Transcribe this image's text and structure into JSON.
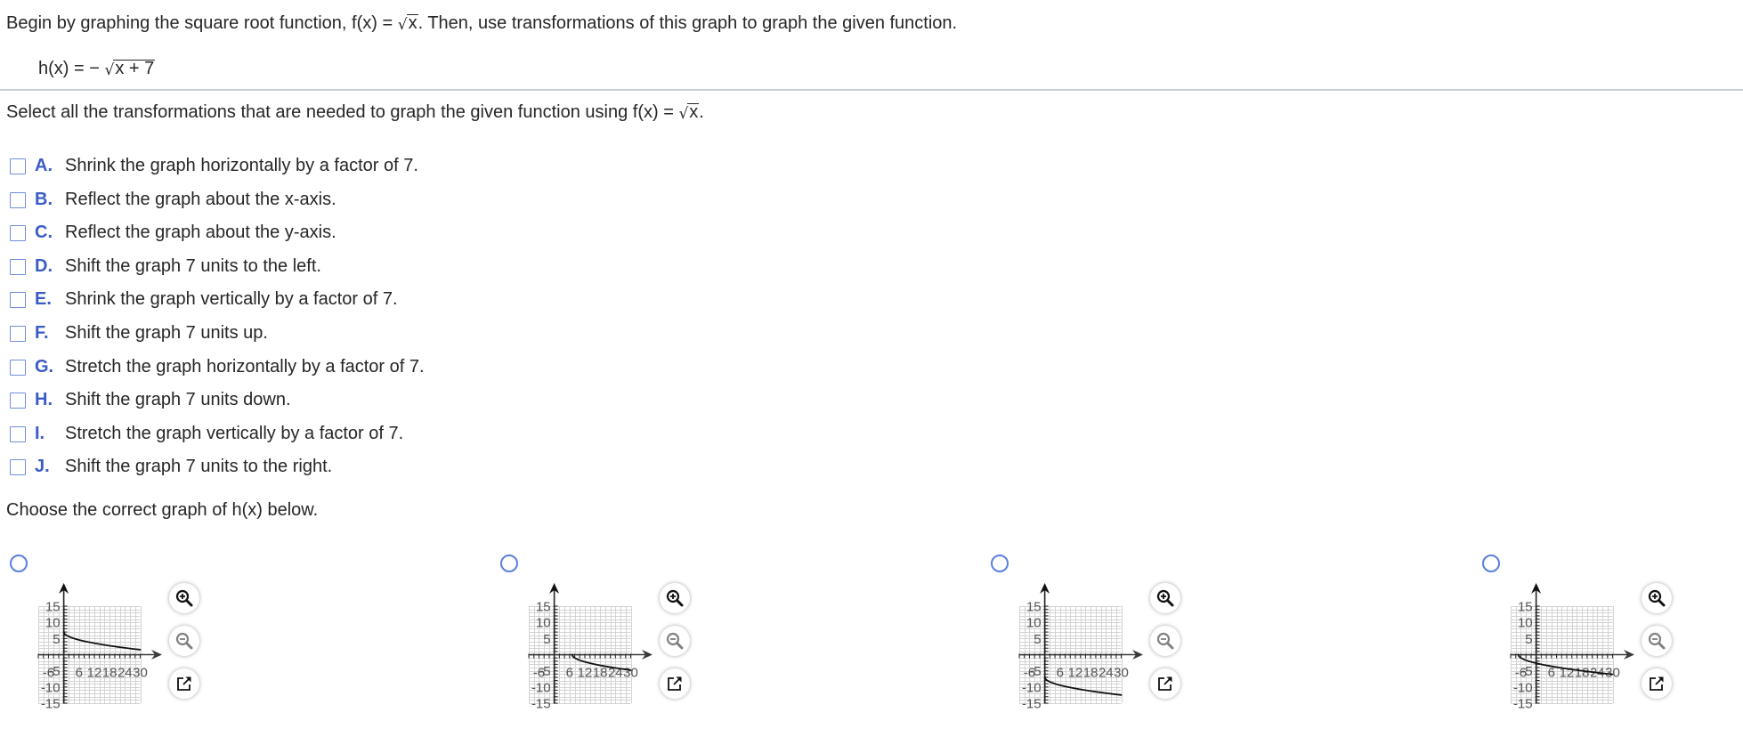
{
  "question": {
    "intro": {
      "before": "Begin by graphing the square root function, f(x) = ",
      "radicand": "x",
      "after": ". Then, use transformations of this graph to graph the given function."
    },
    "given_function": {
      "lhs": "h(x) = ",
      "sign": "− ",
      "radicand": "x + 7"
    }
  },
  "transformations": {
    "prompt": {
      "before": "Select all the transformations that are needed to graph the given function using f(x) = ",
      "radicand": "x",
      "after": "."
    },
    "options": [
      {
        "letter": "A.",
        "text": "Shrink the graph horizontally by a factor of 7.",
        "checked": false
      },
      {
        "letter": "B.",
        "text": "Reflect the graph about the x-axis.",
        "checked": false
      },
      {
        "letter": "C.",
        "text": "Reflect the graph about the y-axis.",
        "checked": false
      },
      {
        "letter": "D.",
        "text": "Shift the graph 7 units to the left.",
        "checked": false
      },
      {
        "letter": "E.",
        "text": "Shrink the graph vertically by a factor of 7.",
        "checked": false
      },
      {
        "letter": "F.",
        "text": "Shift the graph 7 units up.",
        "checked": false
      },
      {
        "letter": "G.",
        "text": "Stretch the graph horizontally by a factor of 7.",
        "checked": false
      },
      {
        "letter": "H.",
        "text": "Shift the graph 7 units down.",
        "checked": false
      },
      {
        "letter": "I.",
        "text": "Stretch the graph vertically by a factor of 7.",
        "checked": false
      },
      {
        "letter": "J.",
        "text": "Shift the graph 7 units to the right.",
        "checked": false
      }
    ]
  },
  "graph_choice": {
    "prompt": "Choose the correct graph of h(x) below.",
    "choices": [
      {
        "selected": false
      },
      {
        "selected": false
      },
      {
        "selected": false
      },
      {
        "selected": false
      }
    ],
    "tools": [
      {
        "name": "zoom-in",
        "icon": "zoom-in-icon",
        "enabled": true
      },
      {
        "name": "zoom-out",
        "icon": "zoom-out-icon",
        "enabled": false
      },
      {
        "name": "open-in-new-window",
        "icon": "popout-icon",
        "enabled": true
      }
    ]
  },
  "colors": {
    "text": "#262626",
    "option_letter": "#3b5cc4",
    "checkbox_border": "#6f8ede",
    "radio_border": "#5b7fe0",
    "divider": "#c9ced8",
    "curve": "#111111",
    "grid": "#d3d3d3",
    "disabled_icon": "#808080"
  },
  "chart_data": [
    {
      "type": "line",
      "title": "",
      "xlabel": "",
      "ylabel": "",
      "xlim": [
        -10,
        30
      ],
      "ylim": [
        -15,
        15
      ],
      "grid": true,
      "grid_step": {
        "x": 2,
        "y": 1
      },
      "tick_step": {
        "x": 2,
        "y": 1
      },
      "xticks": [
        {
          "value": -6,
          "label": "-6"
        },
        {
          "value": 6,
          "label": "6"
        },
        {
          "value": 12,
          "label": "12"
        },
        {
          "value": 18,
          "label": "18"
        },
        {
          "value": 24,
          "label": "24"
        },
        {
          "value": 30,
          "label": "30"
        }
      ],
      "yticks": [
        {
          "value": 15,
          "label": "15"
        },
        {
          "value": 10,
          "label": "10"
        },
        {
          "value": 5,
          "label": "5"
        },
        {
          "value": -5,
          "label": "-5"
        },
        {
          "value": -10,
          "label": "-10"
        },
        {
          "value": -15,
          "label": "-15"
        }
      ],
      "series": [
        {
          "name": "curve",
          "points": [
            [
              0,
              7
            ],
            [
              0.25,
              6.5
            ],
            [
              0.5,
              6.29
            ],
            [
              1,
              6
            ],
            [
              2,
              5.59
            ],
            [
              3,
              5.27
            ],
            [
              4,
              5
            ],
            [
              6,
              4.55
            ],
            [
              8,
              4.17
            ],
            [
              10,
              3.84
            ],
            [
              12,
              3.54
            ],
            [
              15,
              3.13
            ],
            [
              18,
              2.76
            ],
            [
              21,
              2.42
            ],
            [
              24,
              2.1
            ],
            [
              27,
              1.8
            ],
            [
              30,
              1.52
            ]
          ]
        }
      ]
    },
    {
      "type": "line",
      "title": "",
      "xlabel": "",
      "ylabel": "",
      "xlim": [
        -10,
        30
      ],
      "ylim": [
        -15,
        15
      ],
      "grid": true,
      "grid_step": {
        "x": 2,
        "y": 1
      },
      "tick_step": {
        "x": 2,
        "y": 1
      },
      "xticks": [
        {
          "value": -6,
          "label": "-6"
        },
        {
          "value": 6,
          "label": "6"
        },
        {
          "value": 12,
          "label": "12"
        },
        {
          "value": 18,
          "label": "18"
        },
        {
          "value": 24,
          "label": "24"
        },
        {
          "value": 30,
          "label": "30"
        }
      ],
      "yticks": [
        {
          "value": 15,
          "label": "15"
        },
        {
          "value": 10,
          "label": "10"
        },
        {
          "value": 5,
          "label": "5"
        },
        {
          "value": -5,
          "label": "-5"
        },
        {
          "value": -10,
          "label": "-10"
        },
        {
          "value": -15,
          "label": "-15"
        }
      ],
      "series": [
        {
          "name": "curve",
          "points": [
            [
              7,
              0
            ],
            [
              7.25,
              -0.5
            ],
            [
              7.5,
              -0.71
            ],
            [
              8,
              -1
            ],
            [
              9,
              -1.41
            ],
            [
              10,
              -1.73
            ],
            [
              11,
              -2
            ],
            [
              13,
              -2.45
            ],
            [
              15,
              -2.83
            ],
            [
              17,
              -3.16
            ],
            [
              19,
              -3.46
            ],
            [
              22,
              -3.87
            ],
            [
              25,
              -4.24
            ],
            [
              28,
              -4.58
            ],
            [
              30,
              -4.8
            ]
          ]
        }
      ]
    },
    {
      "type": "line",
      "title": "",
      "xlabel": "",
      "ylabel": "",
      "xlim": [
        -10,
        30
      ],
      "ylim": [
        -15,
        15
      ],
      "grid": true,
      "grid_step": {
        "x": 2,
        "y": 1
      },
      "tick_step": {
        "x": 2,
        "y": 1
      },
      "xticks": [
        {
          "value": -6,
          "label": "-6"
        },
        {
          "value": 6,
          "label": "6"
        },
        {
          "value": 12,
          "label": "12"
        },
        {
          "value": 18,
          "label": "18"
        },
        {
          "value": 24,
          "label": "24"
        },
        {
          "value": 30,
          "label": "30"
        }
      ],
      "yticks": [
        {
          "value": 15,
          "label": "15"
        },
        {
          "value": 10,
          "label": "10"
        },
        {
          "value": 5,
          "label": "5"
        },
        {
          "value": -5,
          "label": "-5"
        },
        {
          "value": -10,
          "label": "-10"
        },
        {
          "value": -15,
          "label": "-15"
        }
      ],
      "series": [
        {
          "name": "curve",
          "points": [
            [
              0,
              -7
            ],
            [
              0.25,
              -7.5
            ],
            [
              0.5,
              -7.71
            ],
            [
              1,
              -8
            ],
            [
              2,
              -8.41
            ],
            [
              3,
              -8.73
            ],
            [
              4,
              -9
            ],
            [
              6,
              -9.45
            ],
            [
              8,
              -9.83
            ],
            [
              10,
              -10.16
            ],
            [
              12,
              -10.46
            ],
            [
              15,
              -10.87
            ],
            [
              18,
              -11.24
            ],
            [
              21,
              -11.58
            ],
            [
              24,
              -11.9
            ],
            [
              27,
              -12.2
            ],
            [
              30,
              -12.48
            ]
          ]
        }
      ]
    },
    {
      "type": "line",
      "title": "",
      "xlabel": "",
      "ylabel": "",
      "xlim": [
        -10,
        30
      ],
      "ylim": [
        -15,
        15
      ],
      "grid": true,
      "grid_step": {
        "x": 2,
        "y": 1
      },
      "tick_step": {
        "x": 2,
        "y": 1
      },
      "xticks": [
        {
          "value": -6,
          "label": "-6"
        },
        {
          "value": 6,
          "label": "6"
        },
        {
          "value": 12,
          "label": "12"
        },
        {
          "value": 18,
          "label": "18"
        },
        {
          "value": 24,
          "label": "24"
        },
        {
          "value": 30,
          "label": "30"
        }
      ],
      "yticks": [
        {
          "value": 15,
          "label": "15"
        },
        {
          "value": 10,
          "label": "10"
        },
        {
          "value": 5,
          "label": "5"
        },
        {
          "value": -5,
          "label": "-5"
        },
        {
          "value": -10,
          "label": "-10"
        },
        {
          "value": -15,
          "label": "-15"
        }
      ],
      "series": [
        {
          "name": "curve",
          "points": [
            [
              -7,
              0
            ],
            [
              -6.75,
              -0.5
            ],
            [
              -6.5,
              -0.71
            ],
            [
              -6,
              -1
            ],
            [
              -5,
              -1.41
            ],
            [
              -4,
              -1.73
            ],
            [
              -3,
              -2
            ],
            [
              -1,
              -2.45
            ],
            [
              1,
              -2.83
            ],
            [
              3,
              -3.16
            ],
            [
              5,
              -3.46
            ],
            [
              8,
              -3.87
            ],
            [
              11,
              -4.24
            ],
            [
              14,
              -4.58
            ],
            [
              18,
              -5
            ],
            [
              22,
              -5.39
            ],
            [
              26,
              -5.74
            ],
            [
              30,
              -6.08
            ]
          ]
        }
      ]
    }
  ]
}
